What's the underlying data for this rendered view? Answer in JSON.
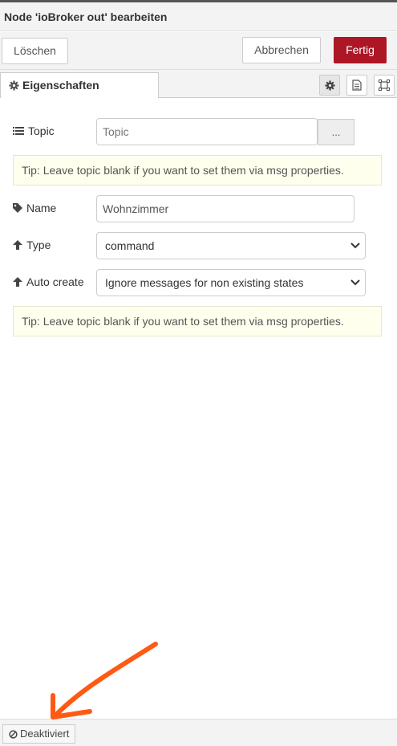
{
  "dialog": {
    "title": "Node 'ioBroker out' bearbeiten"
  },
  "toolbar": {
    "delete_label": "Löschen",
    "cancel_label": "Abbrechen",
    "done_label": "Fertig"
  },
  "tabs": {
    "properties_label": "Eigenschaften"
  },
  "form": {
    "topic": {
      "label": "Topic",
      "placeholder": "Topic",
      "button_label": "..."
    },
    "tip1": "Tip: Leave topic blank if you want to set them via msg properties.",
    "name": {
      "label": "Name",
      "value": "Wohnzimmer"
    },
    "type": {
      "label": "Type",
      "value": "command"
    },
    "autocreate": {
      "label": "Auto create",
      "value": "Ignore messages for non existing states"
    },
    "tip2": "Tip: Leave topic blank if you want to set them via msg properties."
  },
  "footer": {
    "status_label": "Deaktiviert"
  },
  "colors": {
    "primary": "#ad1625",
    "annotation_arrow": "#ff5a14"
  },
  "icons": [
    "cog-icon",
    "document-icon",
    "frame-icon",
    "list-icon",
    "tag-icon",
    "arrow-up-icon",
    "ban-icon",
    "chevron-down-icon"
  ]
}
